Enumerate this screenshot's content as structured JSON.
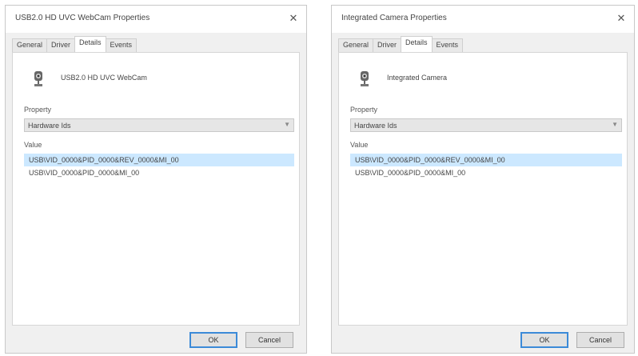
{
  "left_dialog": {
    "title": "USB2.0 HD UVC WebCam Properties",
    "close": "✕",
    "tabs": [
      {
        "label": "General"
      },
      {
        "label": "Driver"
      },
      {
        "label": "Details"
      },
      {
        "label": "Events"
      }
    ],
    "device_name": "USB2.0 HD UVC WebCam",
    "property_label": "Property",
    "property_value": "Hardware Ids",
    "value_label": "Value",
    "values": [
      "USB\\VID_0000&PID_0000&REV_0000&MI_00",
      "USB\\VID_0000&PID_0000&MI_00"
    ],
    "ok_label": "OK",
    "cancel_label": "Cancel"
  },
  "right_dialog": {
    "title": "Integrated Camera Properties",
    "close": "✕",
    "tabs": [
      {
        "label": "General"
      },
      {
        "label": "Driver"
      },
      {
        "label": "Details"
      },
      {
        "label": "Events"
      }
    ],
    "device_name": "Integrated Camera",
    "property_label": "Property",
    "property_value": "Hardware Ids",
    "value_label": "Value",
    "values": [
      "USB\\VID_0000&PID_0000&REV_0000&MI_00",
      "USB\\VID_0000&PID_0000&MI_00"
    ],
    "ok_label": "OK",
    "cancel_label": "Cancel"
  }
}
